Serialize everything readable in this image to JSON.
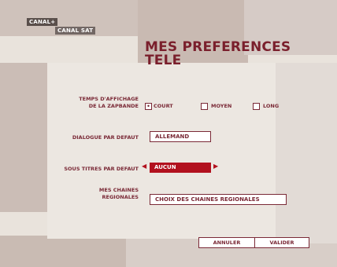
{
  "brand": {
    "canal": "CANAL+",
    "canalsat": "CANAL SAT"
  },
  "title_line1": "MES PREFERENCES",
  "title_line2": "TELE",
  "zapbande": {
    "label_line1": "TEMPS D'AFFICHAGE",
    "label_line2": "DE LA ZAPBANDE",
    "options": [
      {
        "label": "COURT",
        "checked": true
      },
      {
        "label": "MOYEN",
        "checked": false
      },
      {
        "label": "LONG",
        "checked": false
      }
    ],
    "check_mark": "•"
  },
  "dialogue": {
    "label": "DIALOGUE PAR DEFAUT",
    "value": "ALLEMAND"
  },
  "subtitles": {
    "label": "SOUS TITRES PAR DEFAUT",
    "value": "AUCUN",
    "left_arrow": "◀",
    "right_arrow": "▶"
  },
  "regional": {
    "label_line1": "MES CHAINES",
    "label_line2": "REGIONALES",
    "button": "CHOIX DES CHAINES REGIONALES"
  },
  "footer": {
    "cancel": "ANNULER",
    "confirm": "VALIDER"
  },
  "colors": {
    "accent": "#7a2936",
    "selected": "#b2111e"
  }
}
